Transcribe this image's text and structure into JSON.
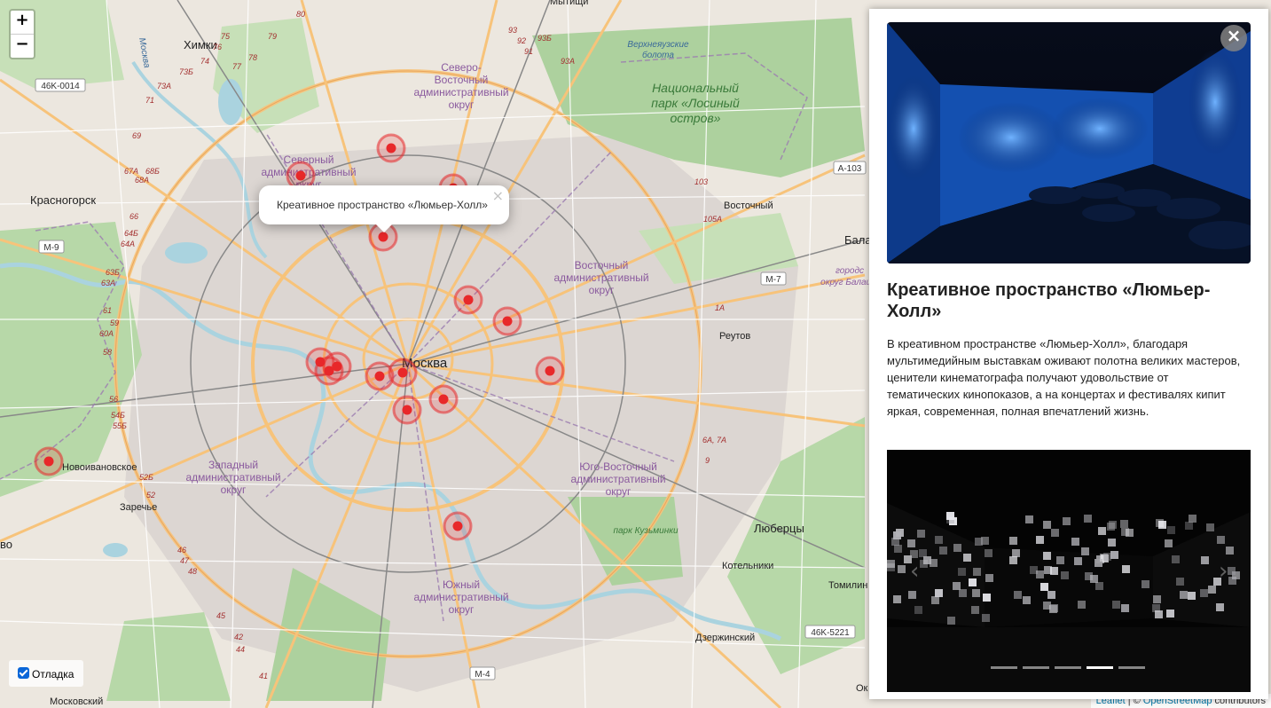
{
  "map": {
    "zoom_in_label": "+",
    "zoom_out_label": "−",
    "labels": {
      "moskva": "Москва",
      "khimki": "Химки",
      "krasnogorsk": "Красногорск",
      "novoivanovskoe": "Новоивановское",
      "zarechye": "Заречье",
      "moskovsky": "Московский",
      "reutov": "Реутов",
      "lyubertsy": "Люберцы",
      "kotelniki": "Котельники",
      "tomilino": "Томилин",
      "dzerzhinsky": "Дзержинский",
      "vostochny": "Восточный",
      "bala": "Бала",
      "vo": "во",
      "ok": "Ок",
      "sevao_1": "Северо-",
      "sevao_2": "Восточный",
      "sevao_3": "административный",
      "sevao_4": "округ",
      "sao_1": "Северный",
      "sao_2": "административный",
      "sao_3": "округ",
      "vao_1": "Восточный",
      "vao_2": "административный",
      "vao_3": "округ",
      "zao_1": "Западный",
      "zao_2": "административный",
      "zao_3": "округ",
      "uvao_1": "Юго-Восточный",
      "uvao_2": "административный",
      "uvao_3": "округ",
      "uao_1": "Южный",
      "uao_2": "административный",
      "uao_3": "округ",
      "park_1": "Национальный",
      "park_2": "парк «Лосиный",
      "park_3": "остров»",
      "bolota_1": "Верхнеяузские",
      "bolota_2": "болота",
      "kuzminki": "парк Кузьминки",
      "gorod_1": "городс",
      "gorod_2": "округ Балаш",
      "moskva_river": "Москва",
      "mitishchi": "Мытищи"
    },
    "shields": {
      "r46k0014": "46K-0014",
      "m9": "M-9",
      "a103": "A-103",
      "m7": "M-7",
      "r46k5221": "46K-5221",
      "m4": "M-4"
    },
    "route_numbers": {
      "n80": "80",
      "n79": "79",
      "n78": "78",
      "n77": "77",
      "n76": "76",
      "n75": "75",
      "n74": "74",
      "n73b": "73Б",
      "n73a": "73A",
      "n71": "71",
      "n69": "69",
      "n67a": "67A",
      "n68b": "68Б",
      "n68a": "68A",
      "n66": "66",
      "n64b": "64Б",
      "n64a": "64A",
      "n63b": "63Б",
      "n63a": "63A",
      "n61": "61",
      "n59": "59",
      "n60a": "60A",
      "n58": "58",
      "n56": "56",
      "n54b": "54Б",
      "n55b": "55Б",
      "n52b": "52Б",
      "n52": "52",
      "n46": "46",
      "n47": "47",
      "n48": "48",
      "n45": "45",
      "n42": "42",
      "n44": "44",
      "n41": "41",
      "n93": "93",
      "n92": "92",
      "n91": "91",
      "n93b": "93Б",
      "n93a": "93A",
      "n103": "103",
      "n105a": "105A",
      "n1a": "1A",
      "n6a7a": "6A, 7A",
      "n9": "9"
    },
    "popup": {
      "text": "Креативное пространство «Люмьер-Холл»",
      "close": "×"
    },
    "debug": {
      "label": "Отладка",
      "checked": true
    },
    "attribution": {
      "leaflet": "Leaflet",
      "sep": " | © ",
      "osm": "OpenStreetMap",
      "contributors": " contributors"
    },
    "markers": [
      {
        "id": "m1"
      },
      {
        "id": "m2"
      },
      {
        "id": "m3"
      },
      {
        "id": "m4"
      },
      {
        "id": "m5"
      },
      {
        "id": "m6"
      },
      {
        "id": "m7"
      },
      {
        "id": "m8"
      },
      {
        "id": "m9"
      },
      {
        "id": "m10"
      },
      {
        "id": "m11"
      },
      {
        "id": "m12"
      },
      {
        "id": "m13"
      },
      {
        "id": "m14"
      },
      {
        "id": "m15"
      },
      {
        "id": "m16"
      }
    ]
  },
  "panel": {
    "close_label": "×",
    "title": "Креативное пространство «Люмьер-Холл»",
    "description": "В креативном пространстве «Люмьер-Холл», благодаря мультимедийным выставкам оживают полотна великих мастеров, ценители кинематографа получают удовольствие от тематических кинопоказов, а на концертах и фестивалях кипит яркая, современная, полная впечатлений жизнь.",
    "carousel": {
      "prev": "‹",
      "next": "›",
      "slide_count": 5,
      "active_slide": 4
    }
  },
  "colors": {
    "marker": "#e8282a",
    "road_major": "#f7c37a",
    "forest": "#add19e",
    "boundary": "#9b7bb0"
  }
}
